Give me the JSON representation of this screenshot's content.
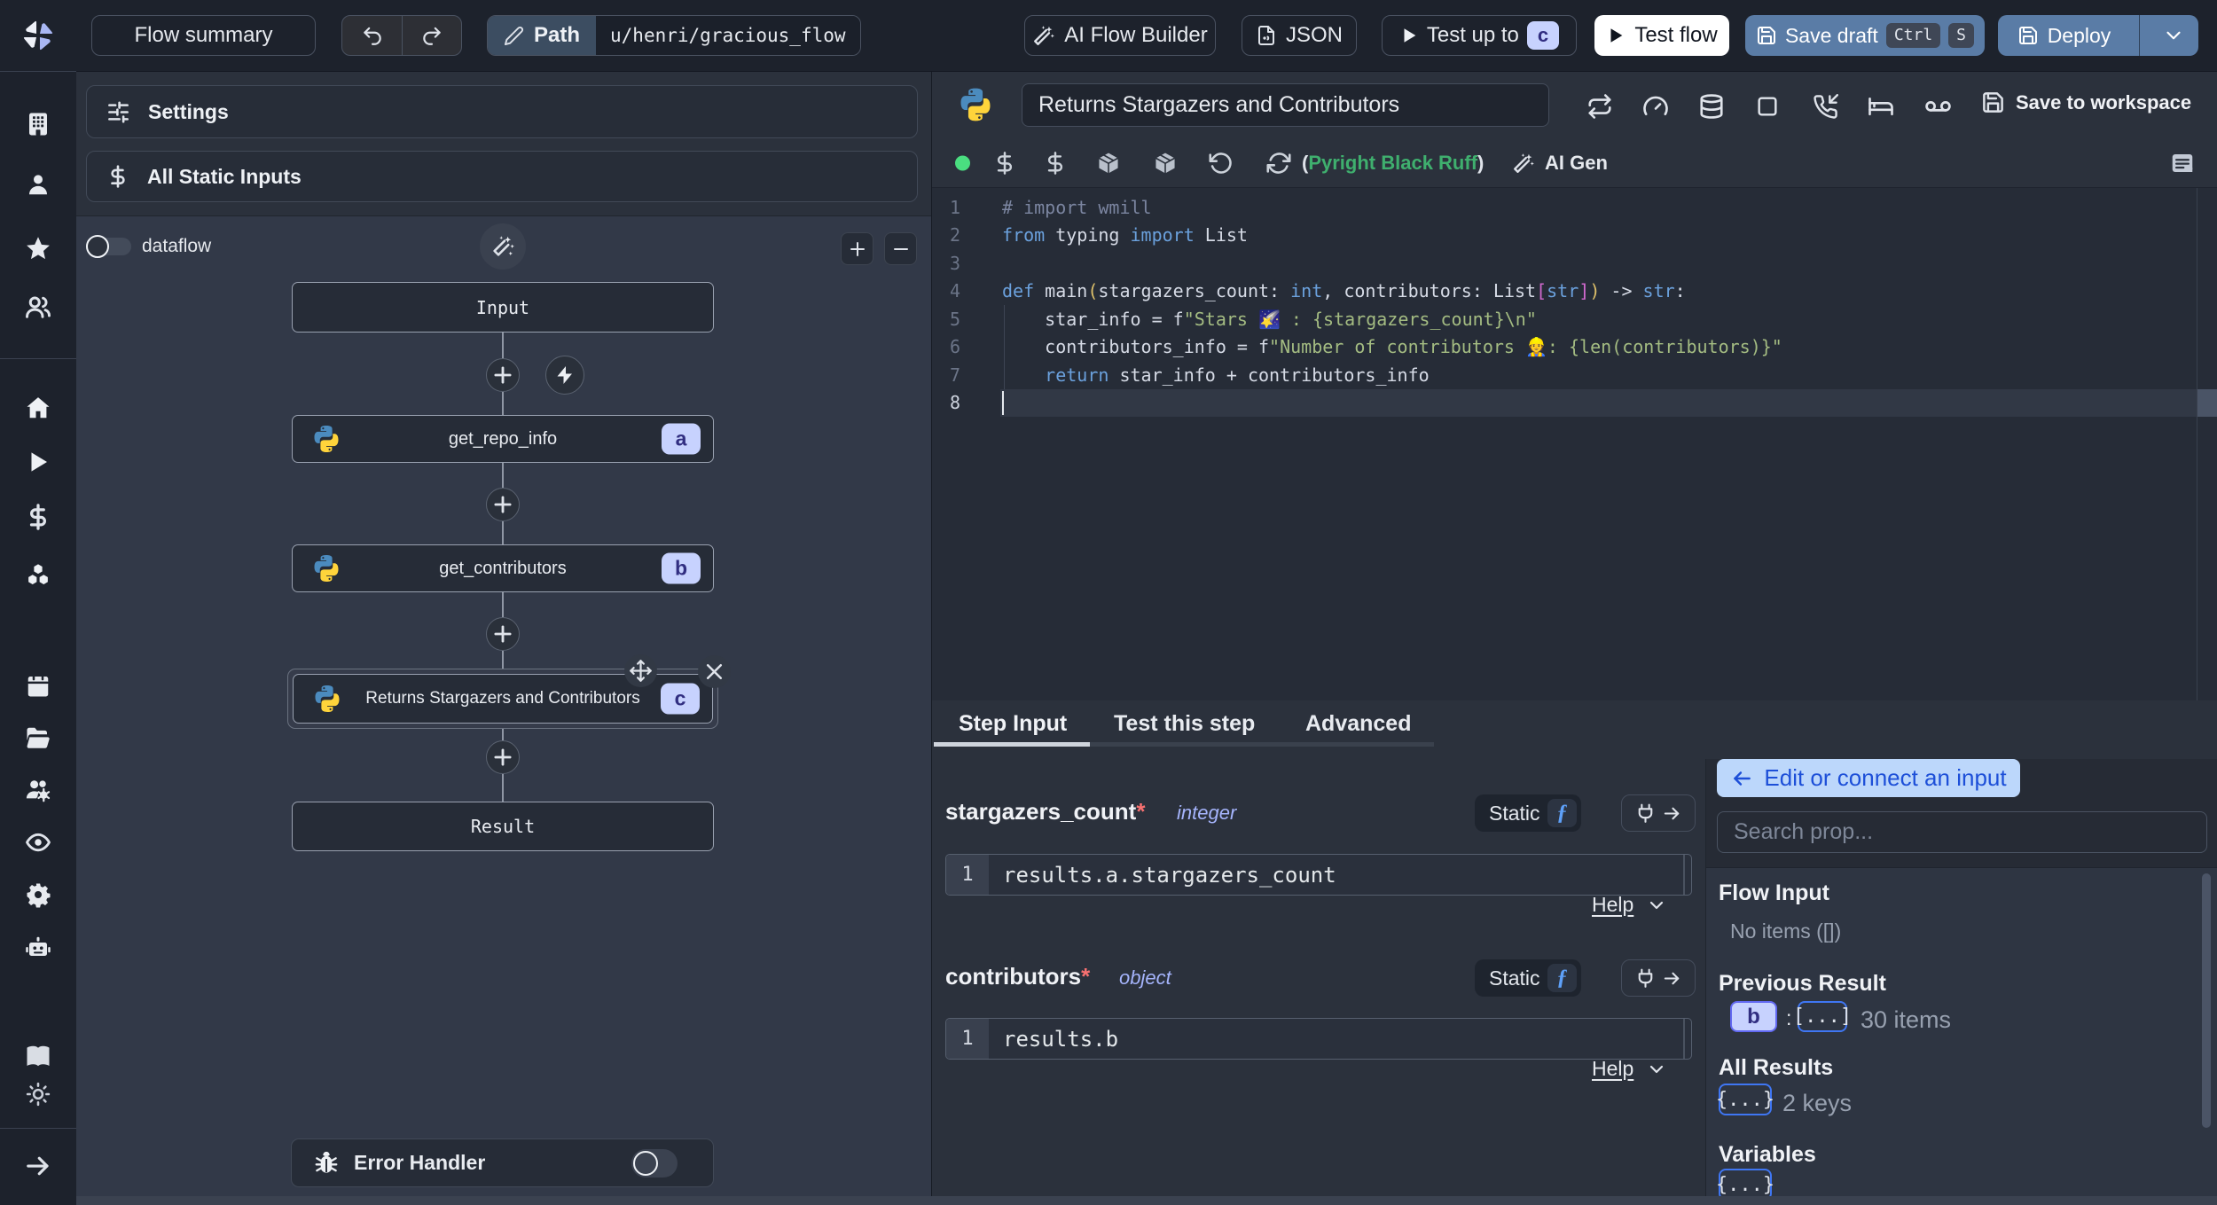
{
  "topbar": {
    "flow_summary": "Flow summary",
    "path_label": "Path",
    "path_value": "u/henri/gracious_flow",
    "ai_flow_builder": "AI Flow Builder",
    "json_label": "JSON",
    "test_up_to": "Test up to",
    "test_up_to_badge": "c",
    "test_flow": "Test flow",
    "save_draft": "Save draft",
    "save_draft_key1": "Ctrl",
    "save_draft_key2": "S",
    "deploy": "Deploy"
  },
  "flow_panel": {
    "settings": "Settings",
    "all_static_inputs": "All Static Inputs",
    "dataflow_label": "dataflow",
    "nodes": {
      "input": "Input",
      "step_a": "get_repo_info",
      "step_b": "get_contributors",
      "step_c": "Returns Stargazers and Contributors",
      "result": "Result"
    },
    "badges": {
      "a": "a",
      "b": "b",
      "c": "c"
    },
    "error_handler": "Error Handler"
  },
  "editor": {
    "title": "Returns Stargazers and Contributors",
    "save_to_workspace": "Save to workspace",
    "lint_open": "(",
    "lint_text": "Pyright Black Ruff",
    "lint_close": ")",
    "ai_gen": "AI Gen",
    "code": {
      "lines": [
        {
          "n": "1",
          "tokens": [
            [
              "c",
              "# import wmill"
            ]
          ]
        },
        {
          "n": "2",
          "tokens": [
            [
              "k",
              "from"
            ],
            [
              "t",
              " typing "
            ],
            [
              "k",
              "import"
            ],
            [
              "t",
              " List"
            ]
          ]
        },
        {
          "n": "3",
          "tokens": []
        },
        {
          "n": "4",
          "tokens": [
            [
              "k",
              "def"
            ],
            [
              "t",
              " main"
            ],
            [
              "y",
              "("
            ],
            [
              "t",
              "stargazers_count: "
            ],
            [
              "k",
              "int"
            ],
            [
              "t",
              ", contributors: List"
            ],
            [
              "p",
              "["
            ],
            [
              "k",
              "str"
            ],
            [
              "p",
              "]"
            ],
            [
              "y",
              ")"
            ],
            [
              "t",
              " -> "
            ],
            [
              "k",
              "str"
            ],
            [
              "t",
              ":"
            ]
          ]
        },
        {
          "n": "5",
          "tokens": [
            [
              "t",
              "    star_info = f"
            ],
            [
              "s",
              "\"Stars 🌠 : {stargazers_count}\\n\""
            ]
          ]
        },
        {
          "n": "6",
          "tokens": [
            [
              "t",
              "    contributors_info = f"
            ],
            [
              "s",
              "\"Number of contributors 👷: {len(contributors)}\""
            ]
          ]
        },
        {
          "n": "7",
          "tokens": [
            [
              "t",
              "    "
            ],
            [
              "k",
              "return"
            ],
            [
              "t",
              " star_info + contributors_info"
            ]
          ]
        },
        {
          "n": "8",
          "tokens": []
        }
      ]
    }
  },
  "step_panel": {
    "tabs": {
      "step_input": "Step Input",
      "test_this_step": "Test this step",
      "advanced": "Advanced"
    },
    "fields": [
      {
        "name": "stargazers_count",
        "required": "*",
        "type": "integer",
        "mode": "Static",
        "fn": "ƒ",
        "expr_line": "1",
        "expr": "results.a.stargazers_count",
        "help": "Help"
      },
      {
        "name": "contributors",
        "required": "*",
        "type": "object",
        "mode": "Static",
        "fn": "ƒ",
        "expr_line": "1",
        "expr": "results.b",
        "help": "Help"
      }
    ]
  },
  "props_panel": {
    "edit_connect": "Edit or connect an input",
    "search_placeholder": "Search prop...",
    "flow_input_title": "Flow Input",
    "flow_input_empty": "No items ([])",
    "previous_result_title": "Previous Result",
    "prev_key_badge": "b",
    "prev_colon": ":",
    "prev_value_badge": "[...]",
    "prev_value_text": "30 items",
    "all_results_title": "All Results",
    "all_results_badge": "{...}",
    "all_results_text": "2 keys",
    "variables_title": "Variables",
    "variables_badge": "{...}"
  },
  "colors": {
    "accent_badge": "#c7d2fe",
    "badge_text": "#312e81",
    "primary_button": "#5a7ca6",
    "lint_green": "#4ade80",
    "status_dot_green": "#4ade80",
    "edit_connect_bg": "#bcd7fb",
    "edit_connect_text": "#1d4fd8",
    "type_purple": "#a5b4fc",
    "required_red": "#f87171",
    "fn_blue": "#5ea0f8"
  }
}
